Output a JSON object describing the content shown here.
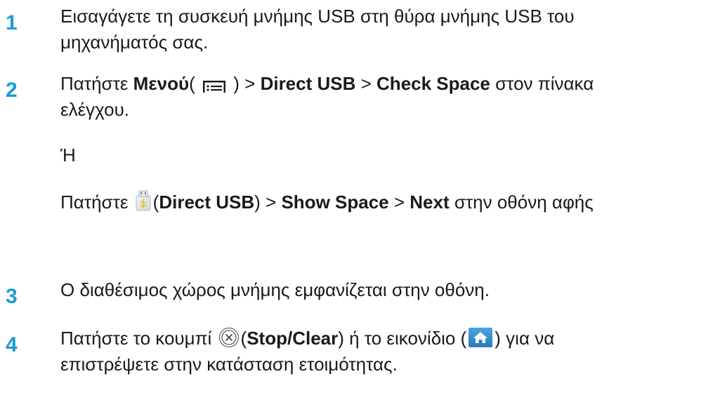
{
  "steps": [
    {
      "number": "1",
      "line1": "Εισαγάγετε τη συσκευή μνήμης USB στη θύρα μνήμης USB του",
      "line2": "μηχανήματός σας."
    },
    {
      "number": "2",
      "pre": "Πατήστε ",
      "menu_label": "Μενού",
      "open_paren": "( ",
      "close_paren": " ) > ",
      "direct_usb": "Direct USB",
      "sep": " > ",
      "check_space": "Check Space",
      "post": " στον πίνακα",
      "line2": "ελέγχου.",
      "or_text": "Ή",
      "alt_pre": "Πατήστε ",
      "alt_open": "(",
      "alt_direct_usb": "Direct USB",
      "alt_close_sep": ") > ",
      "alt_show_space": "Show Space",
      "alt_sep": " > ",
      "alt_next": "Next",
      "alt_post": " στην οθόνη αφής"
    },
    {
      "number": "3",
      "line1": "Ο διαθέσιμος χώρος μνήμης εμφανίζεται στην οθόνη."
    },
    {
      "number": "4",
      "pre": "Πατήστε το κουμπί ",
      "open_paren": "(",
      "stop_clear": "Stop/Clear",
      "mid": ") ή το εικονίδιο (",
      "post": ") για να",
      "line2": "επιστρέψετε στην κατάσταση ετοιμότητας."
    }
  ],
  "icons": {
    "menu": "menu-icon",
    "usb": "usb-icon",
    "stop": "stop-clear-icon",
    "home": "home-icon"
  },
  "colors": {
    "step_number": "#1a9ad6",
    "text": "#1a1a1a",
    "home_icon_bg": "#2f8fd0"
  }
}
